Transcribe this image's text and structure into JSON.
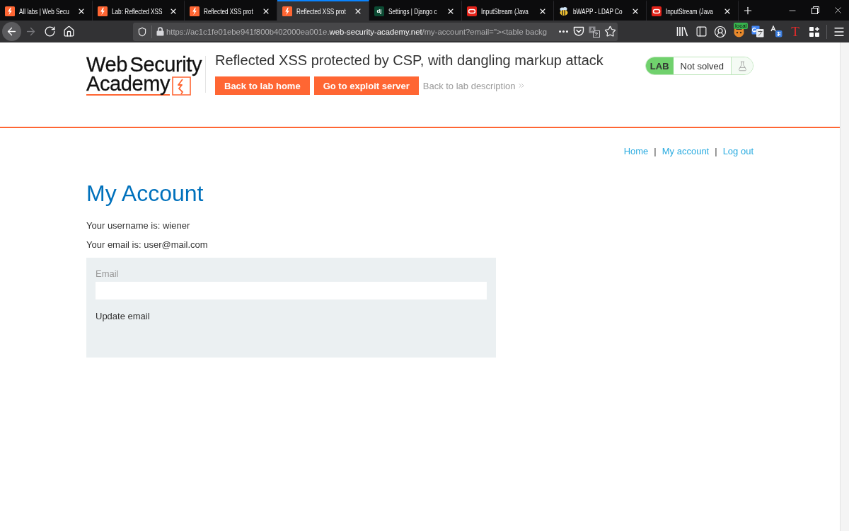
{
  "browser": {
    "tabs": [
      {
        "title": "All labs | Web Secu",
        "kind": "lightning",
        "selected": false
      },
      {
        "title": "Lab: Reflected XSS",
        "kind": "lightning",
        "selected": false
      },
      {
        "title": "Reflected XSS prot",
        "kind": "lightning",
        "selected": false
      },
      {
        "title": "Reflected XSS prot",
        "kind": "lightning",
        "selected": true
      },
      {
        "title": "Settings | Django c",
        "kind": "letters",
        "favicon_text": "dj",
        "selected": false
      },
      {
        "title": "InputStream (Java",
        "kind": "oracle",
        "selected": false
      },
      {
        "title": "bWAPP - LDAP Co",
        "kind": "bee",
        "selected": false
      },
      {
        "title": "InputStream (Java",
        "kind": "oracle",
        "selected": false
      }
    ],
    "nav_buttons": [
      {
        "kind": "back",
        "disabled": false,
        "hovered": true
      },
      {
        "kind": "forward",
        "disabled": true,
        "hovered": false
      },
      {
        "kind": "reload",
        "disabled": false,
        "hovered": false
      },
      {
        "kind": "home",
        "disabled": false,
        "hovered": false
      }
    ],
    "address": {
      "scheme_and_subdomain": "https://ac1c1fe01ebe941f800b402000ea001e.",
      "domain": "web-security-academy.net",
      "path": "/my-account?email=\"><table backg"
    },
    "toolbar": {
      "extension_badge": "local",
      "letter_extension": "T"
    }
  },
  "page": {
    "logo": {
      "line_1": "Web Security",
      "line_2": "Academy"
    },
    "lab_title": "Reflected XSS protected by CSP, with dangling markup attack",
    "lab_buttons": [
      "Back to lab home",
      "Go to exploit server"
    ],
    "description_link": "Back to lab description",
    "lab_status": {
      "tag": "LAB",
      "status": "Not solved",
      "solved": false
    },
    "nav": [
      {
        "kind": "link",
        "text": "Home"
      },
      {
        "kind": "separator",
        "text": "|"
      },
      {
        "kind": "link",
        "text": "My account"
      },
      {
        "kind": "separator",
        "text": "|"
      },
      {
        "kind": "link",
        "text": "Log out"
      }
    ],
    "heading": "My Account",
    "details": [
      "Your username is: wiener",
      "Your email is: user@mail.com"
    ],
    "email_form": {
      "label": "Email",
      "submit": "Update email"
    }
  }
}
